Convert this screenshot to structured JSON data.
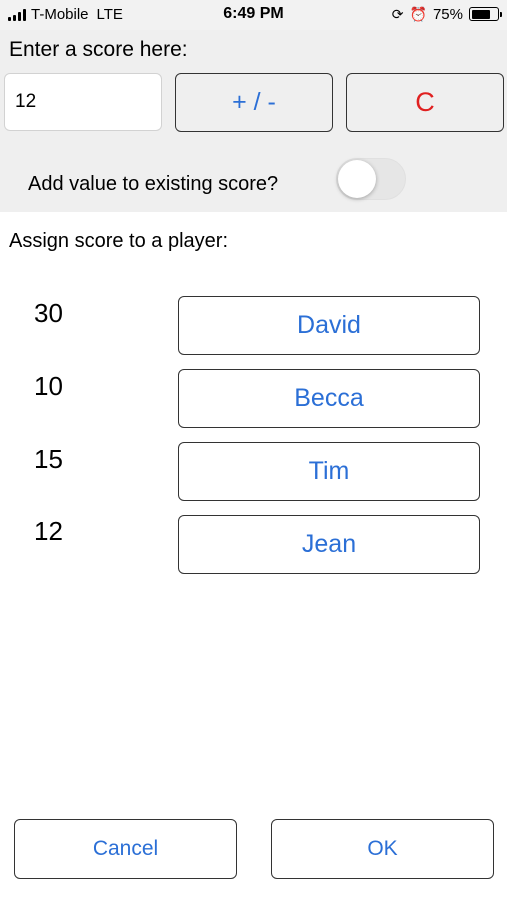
{
  "status_bar": {
    "carrier": "T-Mobile",
    "network": "LTE",
    "time": "6:49 PM",
    "battery_percent": "75%",
    "battery_level": 0.75,
    "icons": [
      "signal-bars-icon",
      "orientation-lock-icon",
      "alarm-icon",
      "battery-icon"
    ]
  },
  "score_entry": {
    "label": "Enter a score here:",
    "input_value": "12",
    "sign_button_label": "+ / -",
    "clear_button_label": "C",
    "add_toggle_label": "Add value to existing score?",
    "add_toggle_on": false
  },
  "assign": {
    "label": "Assign score to a player:",
    "players": [
      {
        "name": "David",
        "score": "30"
      },
      {
        "name": "Becca",
        "score": "10"
      },
      {
        "name": "Tim",
        "score": "15"
      },
      {
        "name": "Jean",
        "score": "12"
      }
    ]
  },
  "footer": {
    "cancel_label": "Cancel",
    "ok_label": "OK"
  },
  "colors": {
    "accent_blue": "#2b6fd6",
    "clear_red": "#e02020",
    "panel_gray": "#efefef"
  }
}
